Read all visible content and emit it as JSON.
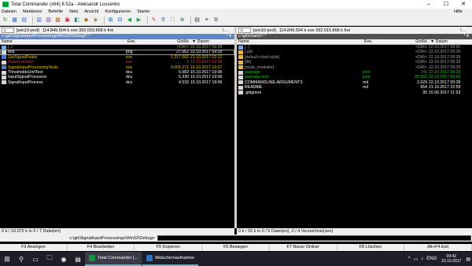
{
  "window": {
    "title": "Total Commander (x64) 8.52a - Aleksandr Lossenko",
    "controls": [
      "–",
      "☐",
      "✕"
    ]
  },
  "menu": [
    "Dateien",
    "Markieren",
    "Befehle",
    "Netz",
    "Ansicht",
    "Konfigurieren",
    "Starter"
  ],
  "menu_help": "Hilfe",
  "toolbar_icons": [
    "↻",
    "▦",
    "▤",
    "▥",
    "▧",
    "▩",
    "▣",
    "◧",
    "◆",
    "◈",
    "⊞",
    "⊟",
    "◀",
    "▶",
    "✎",
    "⚲",
    "⛶",
    "⊛",
    "▤",
    "≡",
    "⚙"
  ],
  "left": {
    "drive": "c",
    "volume": "[win10-prof]",
    "free": "114.849.504 k von 392.015.868 k frei",
    "updir": "\\  ..",
    "path": "c:\\git\\SignalInputProcessings\\Win32\\Debug\\*.*",
    "hist": "* ▾",
    "columns": {
      "name": "Name",
      "ext": "Erw.",
      "size": "Größe",
      "date": "▼ Datum"
    },
    "files": [
      {
        "type": "up",
        "name": "[..]",
        "ext": "",
        "size": "<DIR>",
        "date": "22.10.2017 09:39",
        "color": "#a0a0a0"
      },
      {
        "type": "file",
        "name": "test",
        "ext": "png",
        "size": "27.061",
        "date": "22.10.2017 09:39",
        "color": "#ffffff"
      },
      {
        "type": "exe",
        "name": "GetSignalPeaks",
        "ext": "exe",
        "size": "1.217.002",
        "date": "21.10.2017 22:12",
        "color": "#e0c000"
      },
      {
        "type": "file",
        "name": "dwarfs-results",
        "ext": "exe",
        "size": "3",
        "date": "15.10.2017 19:08",
        "color": "#e03030"
      },
      {
        "type": "exe",
        "name": "SignalInputProcessingTests",
        "ext": "exe",
        "size": "9.055.271",
        "date": "15.10.2017 19:07",
        "color": "#e0c000"
      },
      {
        "type": "file",
        "name": "ThresholdsUnitTest",
        "ext": "dcu",
        "size": "5.083",
        "date": "15.10.2017 19:06",
        "color": "#ffffff"
      },
      {
        "type": "file",
        "name": "InputSignalProcessor",
        "ext": "dcu",
        "size": "5.330",
        "date": "15.10.2017 19:06",
        "color": "#ffffff"
      },
      {
        "type": "file",
        "name": "SignalInputProcess",
        "ext": "dcu",
        "size": "4.533",
        "date": "15.10.2017 19:06",
        "color": "#ffffff"
      }
    ],
    "status": "0 k / 10.072 k in 0 / 7 Datei(en)"
  },
  "right": {
    "drive": "c",
    "volume": "[win10-prof]",
    "free": "114.849.504 k von 392.015.868 k frei",
    "updir": "\\  ..",
    "path": "c:\\git\\charts\\*.*",
    "hist": "* ▾",
    "columns": {
      "name": "Name",
      "ext": "Erw.",
      "size": "Größe",
      "date": "▼ Datum"
    },
    "files": [
      {
        "type": "up",
        "name": "[..]",
        "ext": "",
        "size": "<DIR>",
        "date": "22.10.2017 09:41",
        "color": "#a0a0a0"
      },
      {
        "type": "folder",
        "name": "[.git]",
        "ext": "",
        "size": "<DIR>",
        "date": "22.10.2017 09:39",
        "color": "#a0a0a0"
      },
      {
        "type": "folder",
        "name": "[default-chart-style]",
        "ext": "",
        "size": "<DIR>",
        "date": "22.10.2017 09:39",
        "color": "#a0a0a0"
      },
      {
        "type": "folder",
        "name": "[lib]",
        "ext": "",
        "size": "<DIR>",
        "date": "22.10.2017 09:39",
        "color": "#a0a0a0"
      },
      {
        "type": "folder",
        "name": "[node_modules]",
        "ext": "",
        "size": "<DIR>",
        "date": "22.10.2017 09:39",
        "color": "#a0a0a0"
      },
      {
        "type": "file",
        "name": "package",
        "ext": "json",
        "size": "741",
        "date": "22.10.2017 09:39",
        "color": "#20c020"
      },
      {
        "type": "file",
        "name": "package-lock",
        "ext": "json",
        "size": "25.555",
        "date": "22.10.2017 09:39",
        "color": "#20c020"
      },
      {
        "type": "file",
        "name": "COMMANDLINE-ARGUMENTS",
        "ext": "md",
        "size": "2.029",
        "date": "22.10.2017 09:39",
        "color": "#ffffff"
      },
      {
        "type": "file",
        "name": "README",
        "ext": "md",
        "size": "954",
        "date": "21.10.2017 22:59",
        "color": "#ffffff"
      },
      {
        "type": "file",
        "name": ".gitignore",
        "ext": "",
        "size": "35",
        "date": "15.06.2017 21:53",
        "color": "#ffffff"
      }
    ],
    "status": "0 k / 26 k in 0 / 5 Datei(en), 0 / 4 Verzeichnis(sen)"
  },
  "cmdline": {
    "prompt": "c:\\git\\SignalInputProcessings\\Win32\\Debug>",
    "value": ""
  },
  "fkeys": [
    "F3 Anzeigen",
    "F4 Bearbeiten",
    "F5 Kopieren",
    "F6 Bewegen",
    "F7 Neuer Ordner",
    "F8 Löschen",
    "Alt+F4 Exit"
  ],
  "taskbar": {
    "start_icon": "⊞",
    "icons": [
      "⚲",
      "▭",
      "🗀",
      "◉",
      "▤"
    ],
    "tasks": [
      {
        "label": "Total Commander (...",
        "active": true
      },
      {
        "label": "Bildschirmaufnahme",
        "active": false
      }
    ],
    "tray": [
      "^",
      "▭",
      "♪",
      "ENG"
    ],
    "time": "09:42",
    "date": "22.10.2017",
    "notif_icon": "▤"
  }
}
